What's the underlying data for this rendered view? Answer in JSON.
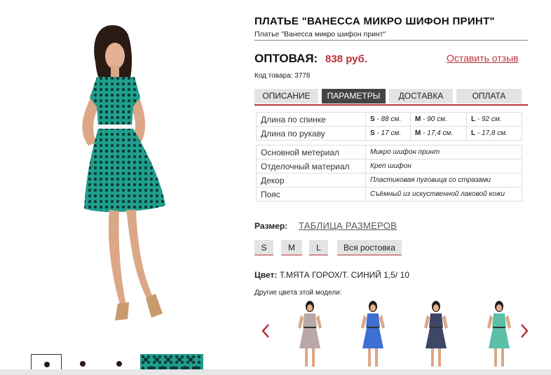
{
  "product": {
    "title": "ПЛАТЬЕ \"ВАНЕССА МИКРО ШИФОН ПРИНТ\"",
    "subtitle": "Платье \"Ванесса микро шифон принт\"",
    "price_label": "ОПТОВАЯ:",
    "price_value": "838 руб.",
    "review_link": "Оставить отзыв",
    "sku": "Код товара: 3778"
  },
  "tabs": [
    {
      "label": "ОПИСАНИЕ",
      "active": false
    },
    {
      "label": "ПАРАМЕТРЫ",
      "active": true
    },
    {
      "label": "ДОСТАВКА",
      "active": false
    },
    {
      "label": "ОПЛАТА",
      "active": false
    }
  ],
  "measurements": [
    {
      "label": "Длина по спинке",
      "s_size": "S",
      "s": " - 88 см.",
      "m_size": "M",
      "m": " - 90 см.",
      "l_size": "L",
      "l": " - 92 см."
    },
    {
      "label": "Длина по рукаву",
      "s_size": "S",
      "s": " - 17 см.",
      "m_size": "M",
      "m": " - 17,4 см.",
      "l_size": "L",
      "l": " - 17,8 см."
    }
  ],
  "materials": [
    {
      "label": "Основной метериал",
      "value": "Микро шифон принт"
    },
    {
      "label": "Отделочный материал",
      "value": "Креп шифон"
    },
    {
      "label": "Декор",
      "value": "Пластиковая пуговица со стразами"
    },
    {
      "label": "Пояс",
      "value": "Съёмный из искуственной лаковой кожи"
    }
  ],
  "sizes": {
    "label": "Размер:",
    "table_link": "ТАБЛИЦА РАЗМЕРОВ",
    "options": [
      "S",
      "M",
      "L",
      "Вся ростовка"
    ]
  },
  "color": {
    "label": "Цвет:",
    "value": "Т.МЯТА ГОРОХ/Т. СИНИЙ 1,5/ 10",
    "other_colors_label": "Другие цвета этой модели:"
  },
  "variant_colors": [
    "#b9a8a6",
    "#3e6fd2",
    "#3e4766",
    "#5bbfa8"
  ],
  "main_dress_color": "#1fa08c",
  "accent_color": "#b8333a"
}
